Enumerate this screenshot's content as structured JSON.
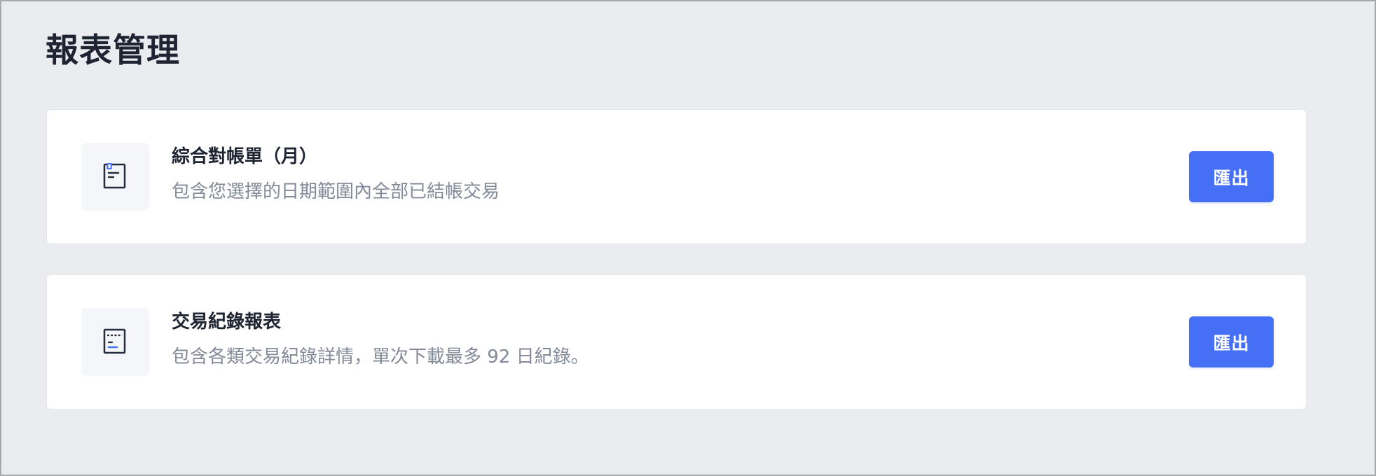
{
  "page": {
    "title": "報表管理"
  },
  "reports": [
    {
      "title": "綜合對帳單（月）",
      "description": "包含您選擇的日期範圍內全部已結帳交易",
      "icon": "monthly-statement-icon",
      "button_label": "匯出"
    },
    {
      "title": "交易紀錄報表",
      "description": "包含各類交易紀錄詳情，單次下載最多 92 日紀錄。",
      "icon": "transaction-report-icon",
      "button_label": "匯出"
    }
  ],
  "colors": {
    "background": "#ebecf0",
    "card": "#ffffff",
    "accent": "#4570f5",
    "title_text": "#1f2433",
    "secondary_text": "#828999"
  }
}
